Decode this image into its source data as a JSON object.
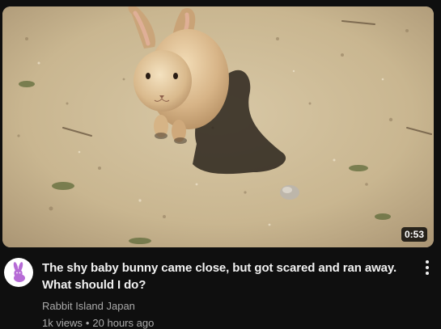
{
  "video": {
    "title": "The shy baby bunny came close, but got scared and ran away. What should I do?",
    "duration": "0:53",
    "channel": "Rabbit Island Japan",
    "views": "1k views",
    "separator": "•",
    "age": "20 hours ago"
  },
  "icons": {
    "avatar": "rabbit-icon",
    "menu": "more-vert-icon"
  },
  "colors": {
    "background": "#0f0f0f",
    "title_text": "#f1f1f1",
    "secondary_text": "#aaaaaa",
    "avatar_rabbit": "#b66bd6"
  }
}
